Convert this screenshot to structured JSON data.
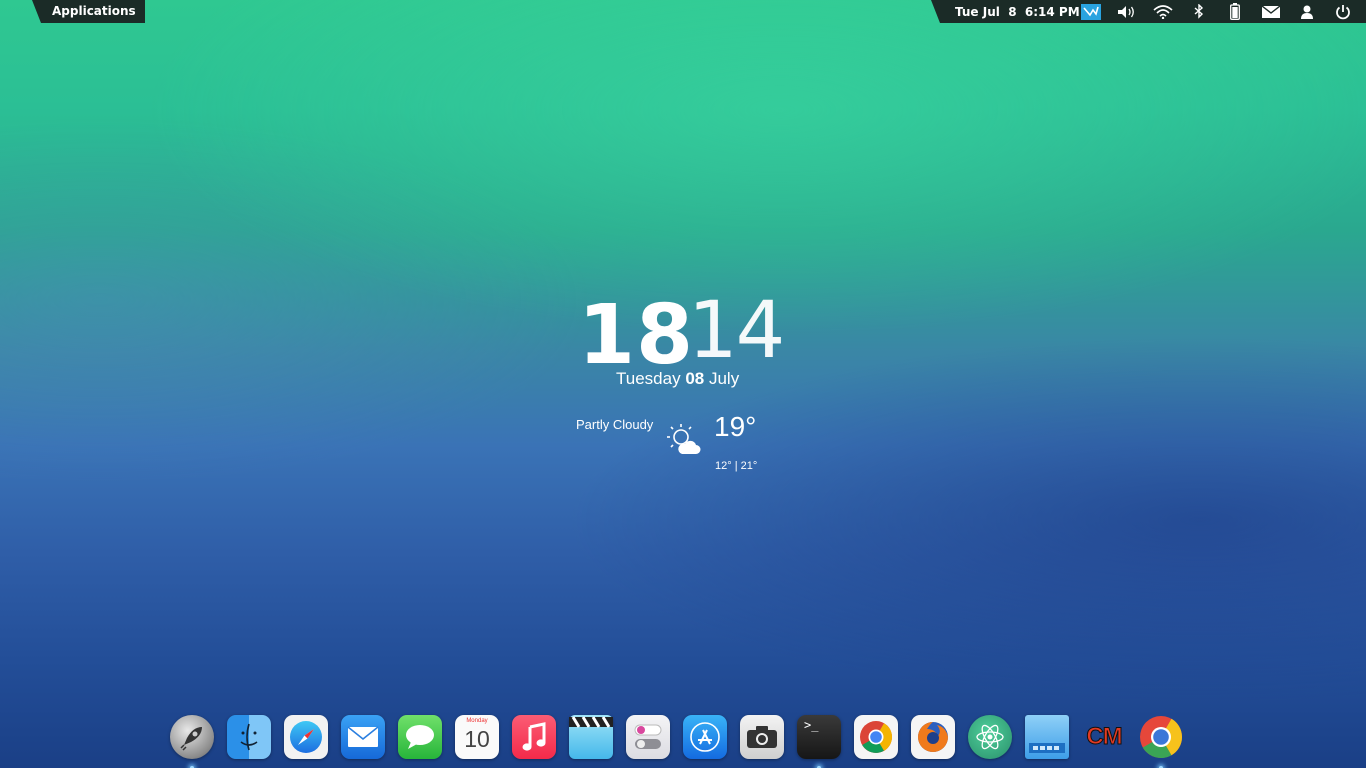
{
  "panel": {
    "menu_label": "Applications",
    "clock": "Tue Jul  8  6:14 PM",
    "tray_icons": [
      "app-indicator-icon",
      "volume-icon",
      "wifi-icon",
      "bluetooth-icon",
      "battery-icon",
      "mail-icon",
      "user-icon",
      "power-icon"
    ]
  },
  "desklet": {
    "hour": "18",
    "separator": ":",
    "minute": "14",
    "weekday": "Tuesday",
    "day": "08",
    "month": "July",
    "condition": "Partly Cloudy",
    "weather_icon": "partly-cloudy-icon",
    "temperature": "19°",
    "range": "12° | 21°"
  },
  "dock": {
    "items": [
      {
        "name": "launchpad",
        "icon": "rocket-icon",
        "running": true
      },
      {
        "name": "finder",
        "icon": "finder-icon",
        "running": false
      },
      {
        "name": "safari",
        "icon": "compass-icon",
        "running": false
      },
      {
        "name": "mail",
        "icon": "envelope-icon",
        "running": false
      },
      {
        "name": "messages",
        "icon": "chat-bubble-icon",
        "running": false
      },
      {
        "name": "calendar",
        "icon": "calendar-icon",
        "month": "Monday",
        "day": "10",
        "running": false
      },
      {
        "name": "music",
        "icon": "music-note-icon",
        "running": false
      },
      {
        "name": "videos",
        "icon": "clapperboard-icon",
        "running": false
      },
      {
        "name": "settings",
        "icon": "toggle-switches-icon",
        "running": false
      },
      {
        "name": "app-store",
        "icon": "app-store-icon",
        "running": false
      },
      {
        "name": "camera",
        "icon": "camera-icon",
        "running": false
      },
      {
        "name": "terminal",
        "icon": "terminal-icon",
        "prompt": ">_",
        "running": true
      },
      {
        "name": "chrome",
        "icon": "chrome-icon",
        "running": false
      },
      {
        "name": "firefox",
        "icon": "firefox-icon",
        "running": false
      },
      {
        "name": "atom",
        "icon": "atom-icon",
        "running": false
      },
      {
        "name": "files",
        "icon": "folder-window-icon",
        "running": false
      },
      {
        "name": "cm",
        "icon": "cm-logo-icon",
        "label": "CM",
        "running": false
      },
      {
        "name": "chromium",
        "icon": "chromium-icon",
        "running": true
      }
    ]
  },
  "colors": {
    "panel_bg": "#1b2b27",
    "indicator": "#9fd8ff",
    "wallpaper_top": "#2fc891",
    "wallpaper_bottom": "#1a3f86"
  }
}
